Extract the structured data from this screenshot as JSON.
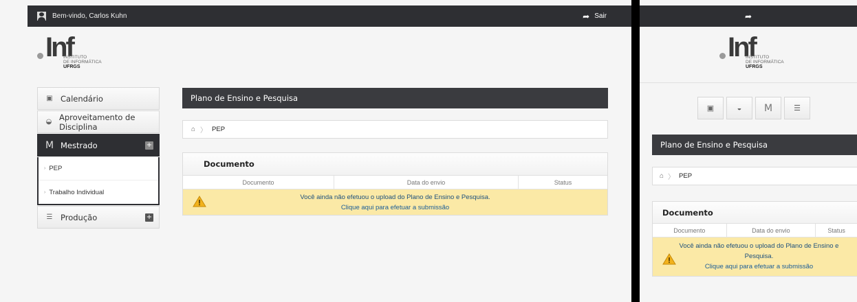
{
  "header": {
    "welcome": "Bem-vindo, Carlos Kuhn",
    "logout_label": "Sair"
  },
  "logo": {
    "word": "Inf",
    "line1": "INSTITUTO",
    "line2": "DE INFORMÁTICA",
    "line3": "UFRGS"
  },
  "sidebar": {
    "items": [
      {
        "label": "Calendário",
        "icon": "calendar-icon"
      },
      {
        "label": "Aproveitamento de Disciplina",
        "icon": "inbox-icon"
      },
      {
        "label": "Mestrado",
        "icon": "m-letter-icon",
        "glyph": "M"
      },
      {
        "label": "Produção",
        "icon": "list-icon"
      }
    ],
    "submenu": [
      {
        "label": "PEP"
      },
      {
        "label": "Trabalho Individual"
      }
    ],
    "expand_symbol": "+"
  },
  "content": {
    "title": "Plano de Ensino e Pesquisa",
    "breadcrumb": "PEP",
    "doc_heading": "Documento",
    "columns": [
      "Documento",
      "Data do envio",
      "Status"
    ],
    "warning_text": "Você ainda não efetuou o upload do Plano de Ensino e Pesquisa.",
    "warning_link": "Clique aqui para efetuar a submissão"
  },
  "mobile": {
    "title": "Plano de Ensino e Pesquisa",
    "breadcrumb": "PEP",
    "doc_heading": "Documento",
    "columns": [
      "Documento",
      "Data do envio",
      "Status"
    ],
    "warning_text": "Você ainda não efetuou o upload do Plano de Ensino e Pesquisa.",
    "warning_link": "Clique aqui para efetuar a submissão",
    "m_glyph": "M"
  },
  "colors": {
    "dark_bar": "#2e2f33",
    "title_bar": "#3a3b3f",
    "warning_bg": "#fbe9a6",
    "link": "#1a5c97"
  }
}
